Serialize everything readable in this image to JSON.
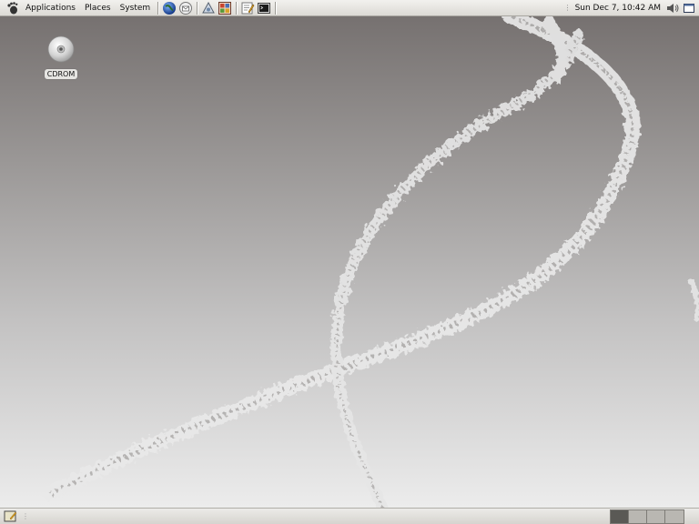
{
  "top_panel": {
    "menus": [
      {
        "label": "Applications",
        "icon": "gnome-foot-icon"
      },
      {
        "label": "Places"
      },
      {
        "label": "System"
      }
    ],
    "launchers": [
      {
        "name": "web-browser-icon"
      },
      {
        "name": "email-client-icon"
      },
      {
        "name": "file-share-icon"
      },
      {
        "name": "presentation-icon"
      },
      {
        "name": "text-editor-icon"
      },
      {
        "name": "terminal-icon"
      }
    ],
    "clock": "Sun Dec  7, 10:42 AM",
    "tray_icons": [
      "volume-icon",
      "show-desktop-icon"
    ]
  },
  "desktop": {
    "icons": [
      {
        "label": "CDROM",
        "icon": "cdrom-icon"
      }
    ]
  },
  "bottom_panel": {
    "show_desktop_icon": "show-desktop-icon",
    "workspace_count": 4,
    "active_workspace": 1
  },
  "colors": {
    "panel": "#dcdad5",
    "desktop_top": "#767170",
    "desktop_bottom": "#ececec",
    "active_workspace": "#5a5955"
  }
}
